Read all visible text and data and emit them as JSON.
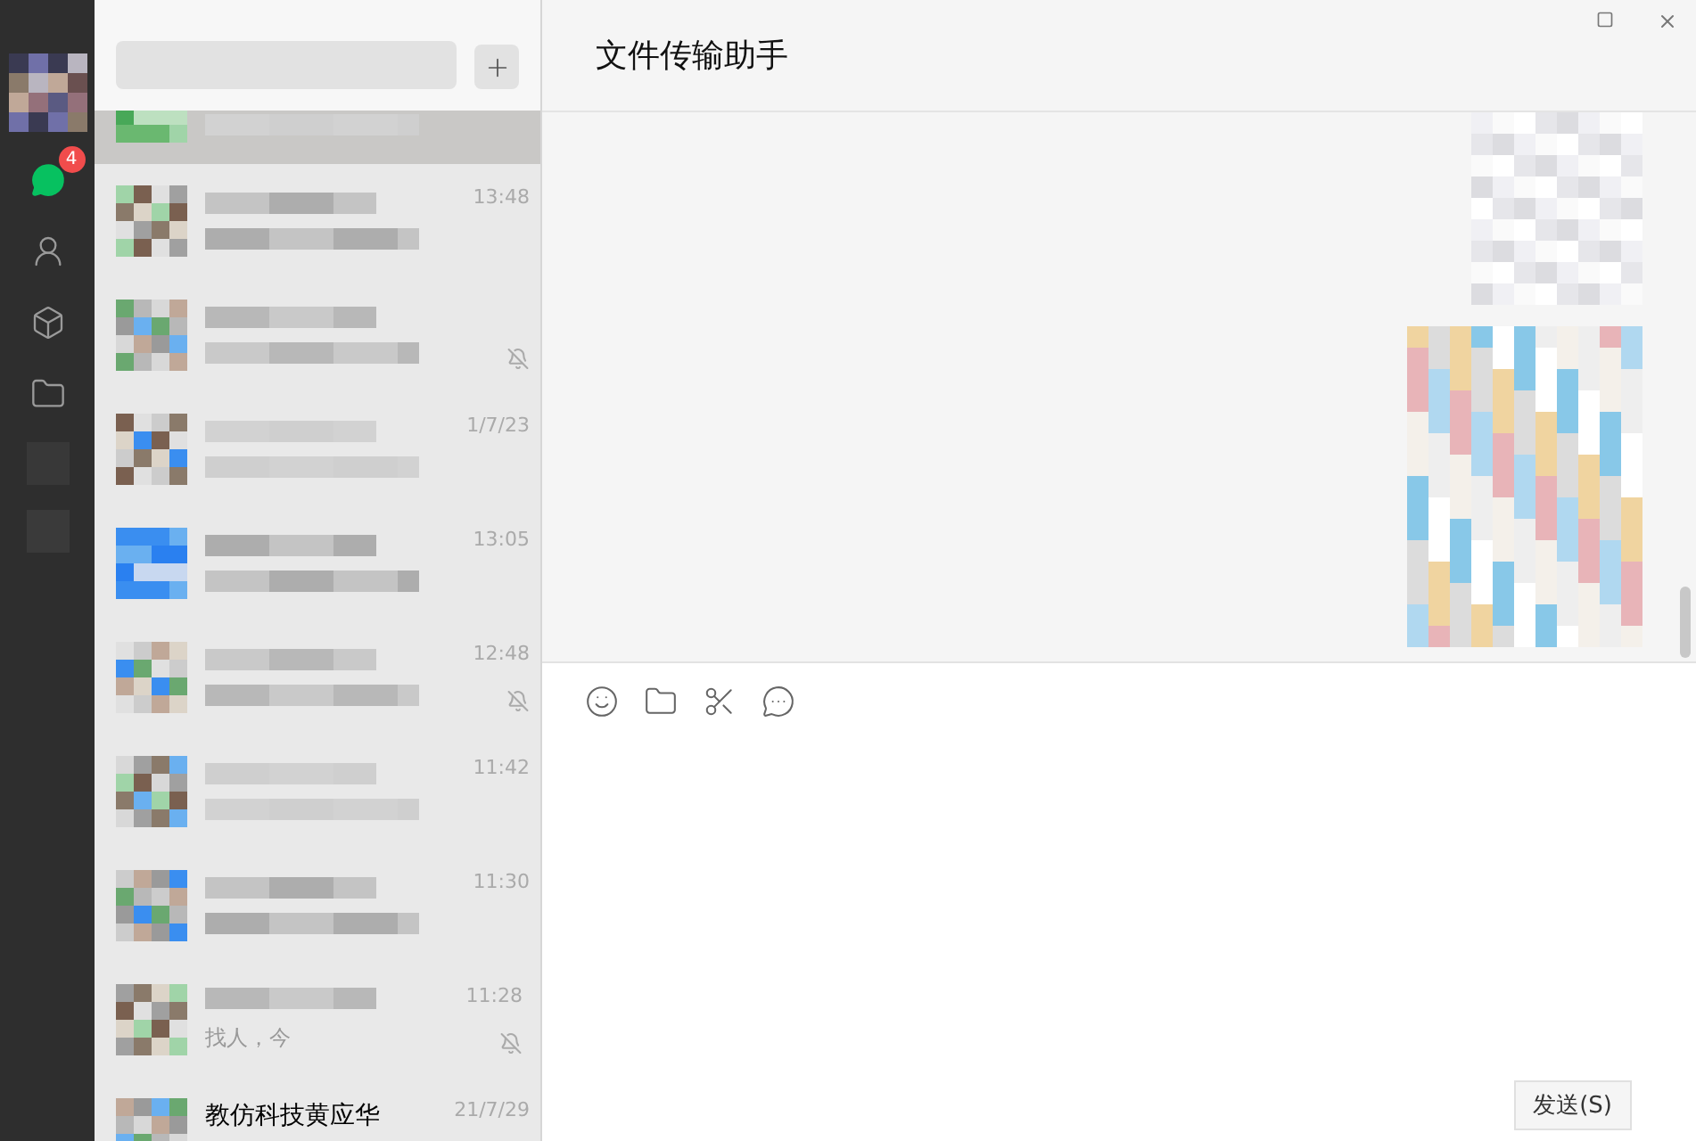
{
  "sidebar": {
    "items": [
      {
        "kind": "chats",
        "selected": true,
        "badge": "4"
      },
      {
        "kind": "contacts",
        "selected": false
      },
      {
        "kind": "favorites",
        "selected": false
      },
      {
        "kind": "files",
        "selected": false
      }
    ]
  },
  "chat_list": {
    "rows": [
      {
        "selected": true,
        "muted": false
      },
      {
        "selected": false,
        "muted": false,
        "time": "13:48"
      },
      {
        "selected": false,
        "muted": true
      },
      {
        "selected": false,
        "muted": false,
        "time": "1/7/23"
      },
      {
        "selected": false,
        "muted": false,
        "time": "13:05"
      },
      {
        "selected": false,
        "muted": true,
        "time": "12:48"
      },
      {
        "selected": false,
        "muted": false,
        "time": "11:42"
      },
      {
        "selected": false,
        "muted": false,
        "time": "11:30"
      },
      {
        "selected": false,
        "muted": true,
        "time": "11:28",
        "preview": "找人，今"
      },
      {
        "selected": false,
        "muted": false,
        "time": "21/7/29",
        "name": "教仿科技黄应华"
      }
    ]
  },
  "chat": {
    "title": "文件传输助手",
    "send_button": "发送(S)"
  }
}
